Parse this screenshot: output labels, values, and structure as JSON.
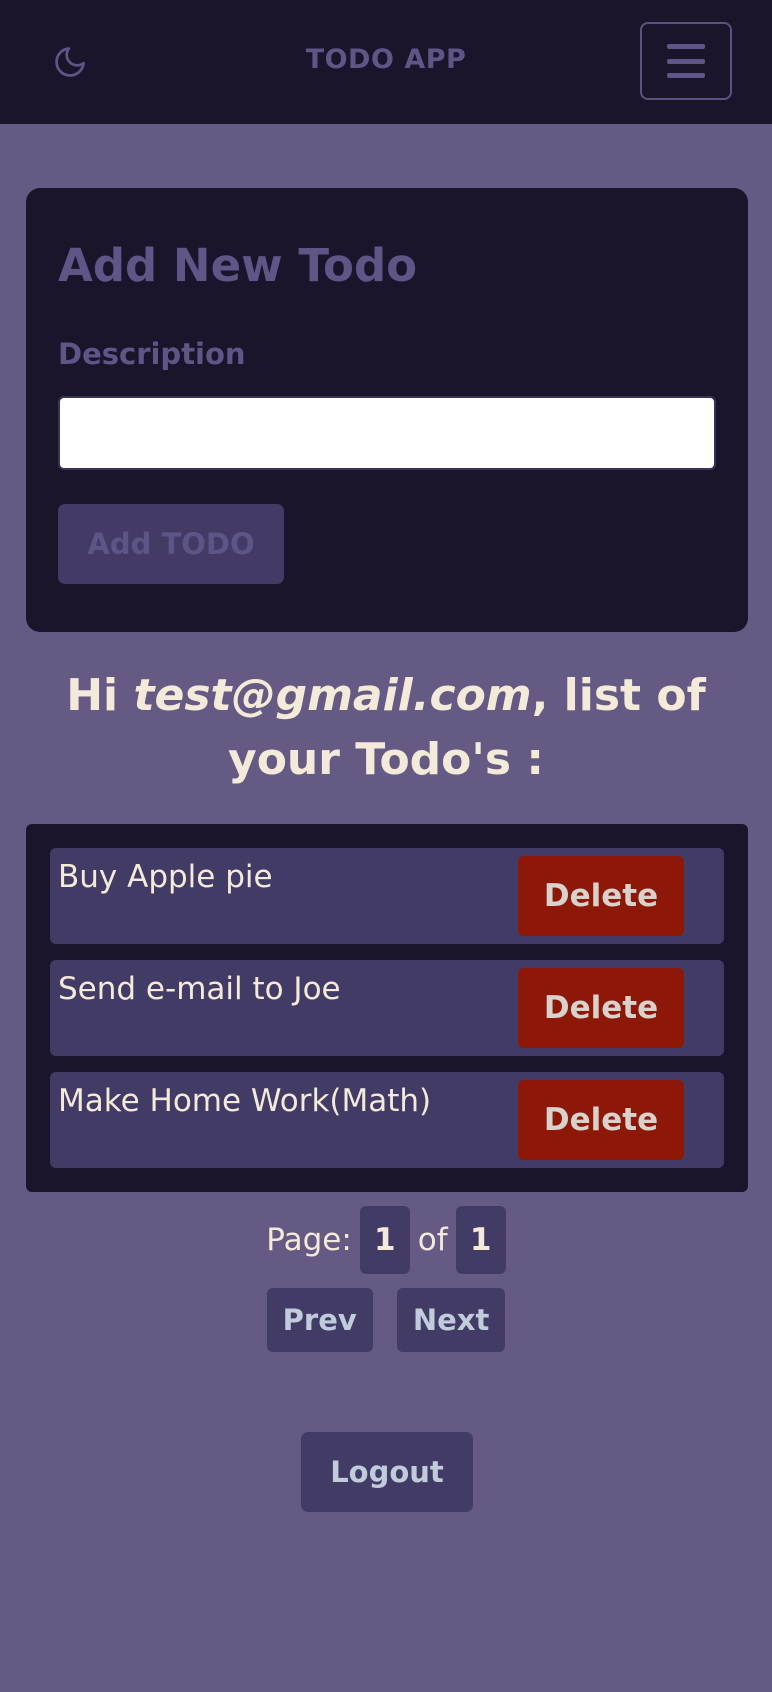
{
  "header": {
    "title": "TODO APP",
    "theme_icon": "moon-icon",
    "menu_icon": "hamburger-menu-icon"
  },
  "add_form": {
    "title": "Add New Todo",
    "description_label": "Description",
    "description_value": "",
    "description_placeholder": "",
    "submit_label": "Add TODO"
  },
  "greeting": {
    "prefix": "Hi ",
    "email": "test@gmail.com",
    "suffix": ", list of your Todo's :"
  },
  "todos": [
    {
      "text": "Buy Apple pie",
      "delete_label": "Delete"
    },
    {
      "text": "Send e-mail to Joe",
      "delete_label": "Delete"
    },
    {
      "text": "Make Home Work(Math)",
      "delete_label": "Delete"
    }
  ],
  "pagination": {
    "page_label": "Page:",
    "current_page": "1",
    "of_label": "of",
    "total_pages": "1",
    "prev_label": "Prev",
    "next_label": "Next"
  },
  "logout_label": "Logout",
  "colors": {
    "background": "#645a84",
    "panel": "#1a152b",
    "item": "#423b66",
    "delete": "#8e1808",
    "muted_text": "#5f5587",
    "light_text": "#f3ead9"
  }
}
